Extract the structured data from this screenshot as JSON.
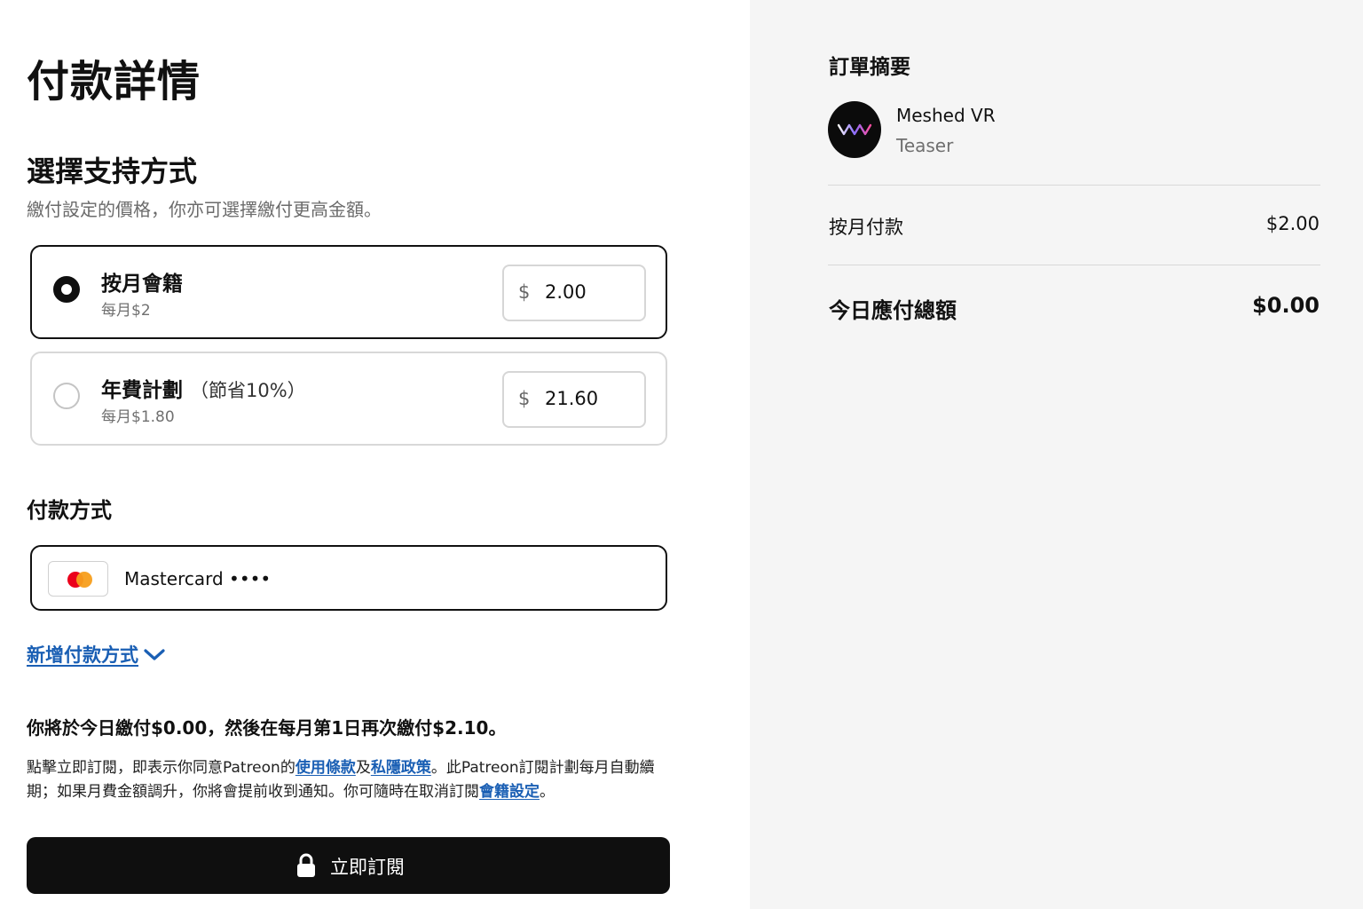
{
  "page": {
    "title": "付款詳情"
  },
  "support": {
    "title": "選擇支持方式",
    "subtitle": "繳付設定的價格，你亦可選擇繳付更高金額。",
    "options": [
      {
        "title": "按月會籍",
        "note": "",
        "sub": "每月$2",
        "currency": "$",
        "amount": "2.00",
        "selected": true
      },
      {
        "title": "年費計劃",
        "note": "（節省10%）",
        "sub": "每月$1.80",
        "currency": "$",
        "amount": "21.60",
        "selected": false
      }
    ]
  },
  "payment_method": {
    "title": "付款方式",
    "card_label": "Mastercard ••••",
    "card_icon": "mastercard-logo",
    "add_label": "新增付款方式",
    "add_icon": "chevron-down-icon"
  },
  "notice": {
    "bold": "你將於今日繳付$0.00，然後在每月第1日再次繳付$2.10。",
    "terms_part1": "點擊立即訂閱，即表示你同意Patreon的",
    "terms_link1": "使用條款",
    "terms_and": "及",
    "terms_link2": "私隱政策",
    "terms_part2": "。此Patreon訂閱計劃每月自動續期；如果月費金額調升，你將會提前收到通知。你可隨時在取消訂閱",
    "terms_link3": "會籍設定",
    "terms_part3": "。"
  },
  "subscribe": {
    "label": "立即訂閱",
    "icon": "lock-icon"
  },
  "summary": {
    "title": "訂單摘要",
    "creator": "Meshed VR",
    "tier": "Teaser",
    "monthly_label": "按月付款",
    "monthly_value": "$2.00",
    "total_label": "今日應付總額",
    "total_value": "$0.00"
  },
  "colors": {
    "accent_link": "#1a5fb4",
    "button_bg": "#0f0f0f",
    "panel_bg": "#f5f5f5"
  }
}
